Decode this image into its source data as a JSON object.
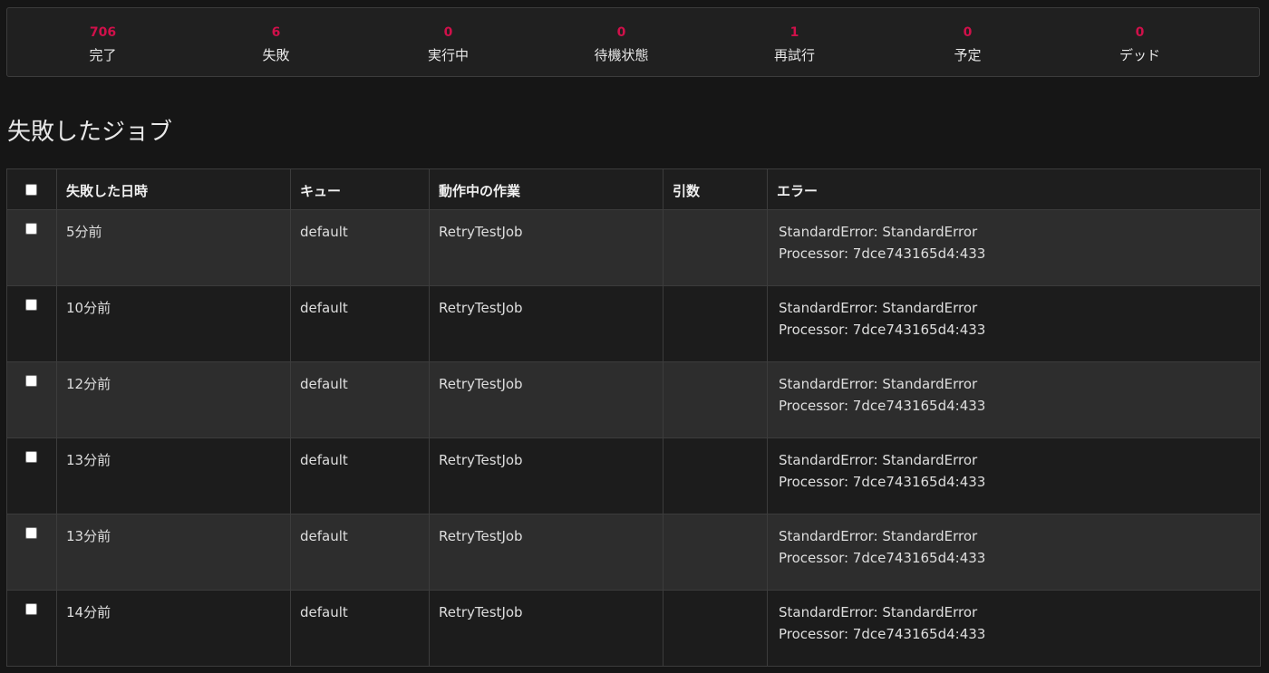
{
  "stats": [
    {
      "count": "706",
      "label": "完了"
    },
    {
      "count": "6",
      "label": "失敗"
    },
    {
      "count": "0",
      "label": "実行中"
    },
    {
      "count": "0",
      "label": "待機状態"
    },
    {
      "count": "1",
      "label": "再試行"
    },
    {
      "count": "0",
      "label": "予定"
    },
    {
      "count": "0",
      "label": "デッド"
    }
  ],
  "page_title": "失敗したジョブ",
  "table": {
    "headers": [
      "失敗した日時",
      "キュー",
      "動作中の作業",
      "引数",
      "エラー"
    ],
    "rows": [
      {
        "time": "5分前",
        "queue": "default",
        "job": "RetryTestJob",
        "args": "",
        "error_line1": "StandardError: StandardError",
        "error_line2": "Processor: 7dce743165d4:433"
      },
      {
        "time": "10分前",
        "queue": "default",
        "job": "RetryTestJob",
        "args": "",
        "error_line1": "StandardError: StandardError",
        "error_line2": "Processor: 7dce743165d4:433"
      },
      {
        "time": "12分前",
        "queue": "default",
        "job": "RetryTestJob",
        "args": "",
        "error_line1": "StandardError: StandardError",
        "error_line2": "Processor: 7dce743165d4:433"
      },
      {
        "time": "13分前",
        "queue": "default",
        "job": "RetryTestJob",
        "args": "",
        "error_line1": "StandardError: StandardError",
        "error_line2": "Processor: 7dce743165d4:433"
      },
      {
        "time": "13分前",
        "queue": "default",
        "job": "RetryTestJob",
        "args": "",
        "error_line1": "StandardError: StandardError",
        "error_line2": "Processor: 7dce743165d4:433"
      },
      {
        "time": "14分前",
        "queue": "default",
        "job": "RetryTestJob",
        "args": "",
        "error_line1": "StandardError: StandardError",
        "error_line2": "Processor: 7dce743165d4:433"
      }
    ]
  },
  "colors": {
    "accent": "#d0104a",
    "background": "#161616"
  }
}
